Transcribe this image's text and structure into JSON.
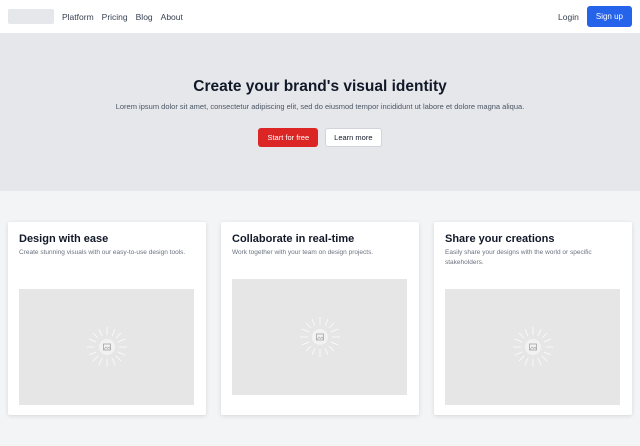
{
  "nav": {
    "links": [
      "Platform",
      "Pricing",
      "Blog",
      "About"
    ],
    "login": "Login",
    "signup": "Sign up"
  },
  "hero": {
    "title": "Create your brand's visual identity",
    "subtitle": "Lorem ipsum dolor sit amet, consectetur adipiscing elit, sed do eiusmod tempor incididunt ut labore et dolore magna aliqua.",
    "primary_button": "Start for free",
    "secondary_button": "Learn more"
  },
  "features": [
    {
      "title": "Design with ease",
      "description": "Create stunning visuals with our easy-to-use design tools.",
      "image_icon": "image-placeholder-icon"
    },
    {
      "title": "Collaborate in real-time",
      "description": "Work together with your team on design projects.",
      "image_icon": "image-placeholder-icon"
    },
    {
      "title": "Share your creations",
      "description": "Easily share your designs with the world or specific stakeholders.",
      "image_icon": "image-placeholder-icon"
    }
  ],
  "colors": {
    "primary_blue": "#2563eb",
    "cta_red": "#dc2626",
    "hero_bg": "#e5e7eb",
    "page_bg": "#f3f4f6"
  }
}
